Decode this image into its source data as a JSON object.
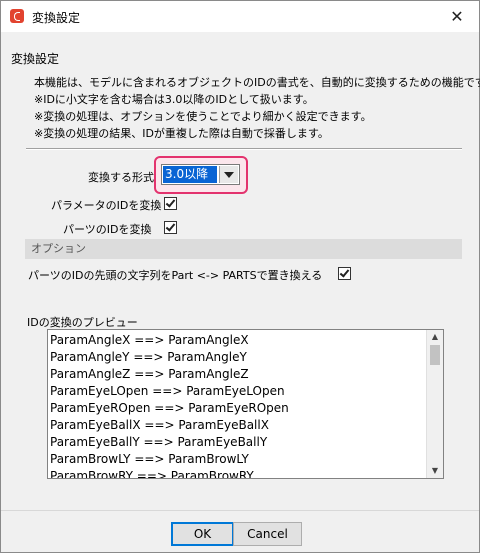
{
  "window": {
    "title": "変換設定"
  },
  "section": {
    "title": "変換設定",
    "description": [
      "本機能は、モデルに含まれるオブジェクトのIDの書式を、自動的に変換するための機能です。",
      "※IDに小文字を含む場合は3.0以降のIDとして扱います。",
      "※変換の処理は、オプションを使うことでより細かく設定できます。",
      "※変換の処理の結果、IDが重複した際は自動で採番します。"
    ]
  },
  "form": {
    "format_label": "変換する形式",
    "format_value": "3.0以降",
    "convert_params_label": "パラメータのIDを変換",
    "convert_params_checked": true,
    "convert_parts_label": "パーツのIDを変換",
    "convert_parts_checked": true
  },
  "options": {
    "header": "オプション",
    "replace_prefix_label": "パーツのIDの先頭の文字列をPart <-> PARTSで置き換える",
    "replace_prefix_checked": true
  },
  "preview": {
    "label": "IDの変換のプレビュー",
    "items": [
      "ParamAngleX ==> ParamAngleX",
      "ParamAngleY ==> ParamAngleY",
      "ParamAngleZ ==> ParamAngleZ",
      "ParamEyeLOpen ==> ParamEyeLOpen",
      "ParamEyeROpen ==> ParamEyeROpen",
      "ParamEyeBallX ==> ParamEyeBallX",
      "ParamEyeBallY ==> ParamEyeBallY",
      "ParamBrowLY ==> ParamBrowLY",
      "ParamBrowRY ==> ParamBrowRY"
    ]
  },
  "buttons": {
    "ok": "OK",
    "cancel": "Cancel"
  },
  "colors": {
    "highlight_border": "#e3336e",
    "selection": "#0a64d4"
  }
}
